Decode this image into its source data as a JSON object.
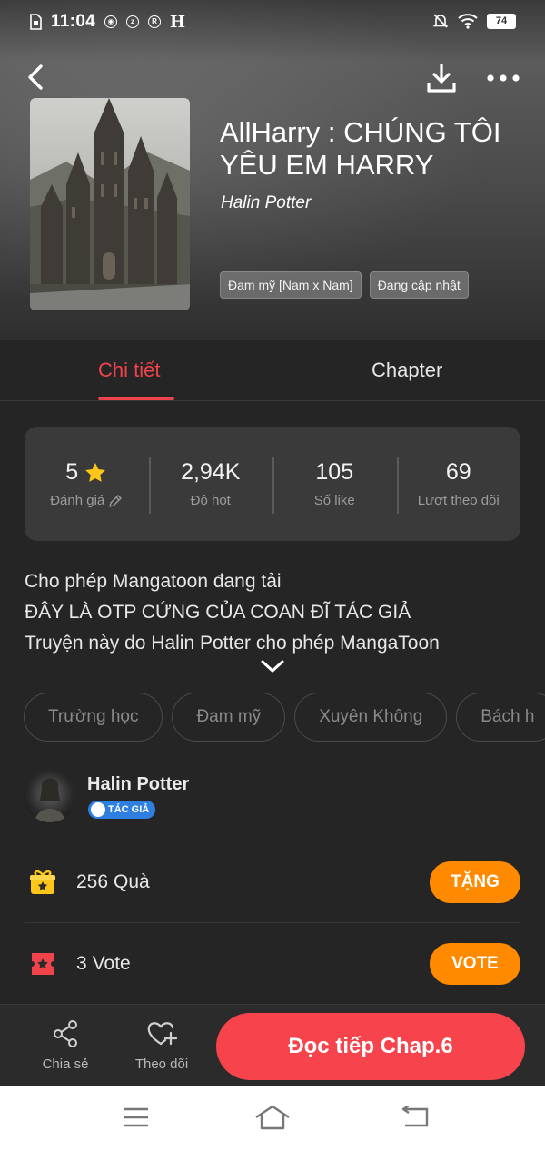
{
  "status_bar": {
    "time": "11:04",
    "indicator_h": "H",
    "battery": "74",
    "icons": [
      "sim-icon",
      "app-icon",
      "z-icon",
      "rt-icon",
      "mute-icon",
      "wifi-icon",
      "battery-icon"
    ]
  },
  "header": {
    "title": "AllHarry : CHÚNG TÔI YÊU EM HARRY",
    "author": "Halin Potter",
    "tags": [
      "Đam mỹ [Nam x Nam]",
      "Đang cập nhật"
    ]
  },
  "tabs": [
    {
      "label": "Chi tiết",
      "active": true
    },
    {
      "label": "Chapter",
      "active": false
    }
  ],
  "stats": [
    {
      "value": "5",
      "label": "Đánh giá"
    },
    {
      "value": "2,94K",
      "label": "Độ hot"
    },
    {
      "value": "105",
      "label": "Số like"
    },
    {
      "value": "69",
      "label": "Lượt theo dõi"
    }
  ],
  "description": [
    "Cho phép Mangatoon đang tải",
    "ĐÂY LÀ OTP CỨNG CỦA COAN ĐĨ TÁC GIẢ",
    "Truyện này do Halin Potter cho phép MangaToon"
  ],
  "genres": [
    "Trường học",
    "Đam mỹ",
    "Xuyên Không",
    "Bách h"
  ],
  "author": {
    "name": "Halin Potter",
    "badge": "TÁC GIẢ"
  },
  "gift": {
    "count": "256",
    "label": "Quà",
    "button": "TẶNG"
  },
  "vote": {
    "count": "3",
    "label": "Vote",
    "button": "VOTE"
  },
  "action_bar": {
    "share_label": "Chia sẻ",
    "follow_label": "Theo dõi",
    "read_label": "Đọc tiếp Chap.6"
  },
  "colors": {
    "accent": "#f0434b",
    "orange": "#ff8a00",
    "star": "#ffc61a",
    "background": "#252525"
  }
}
